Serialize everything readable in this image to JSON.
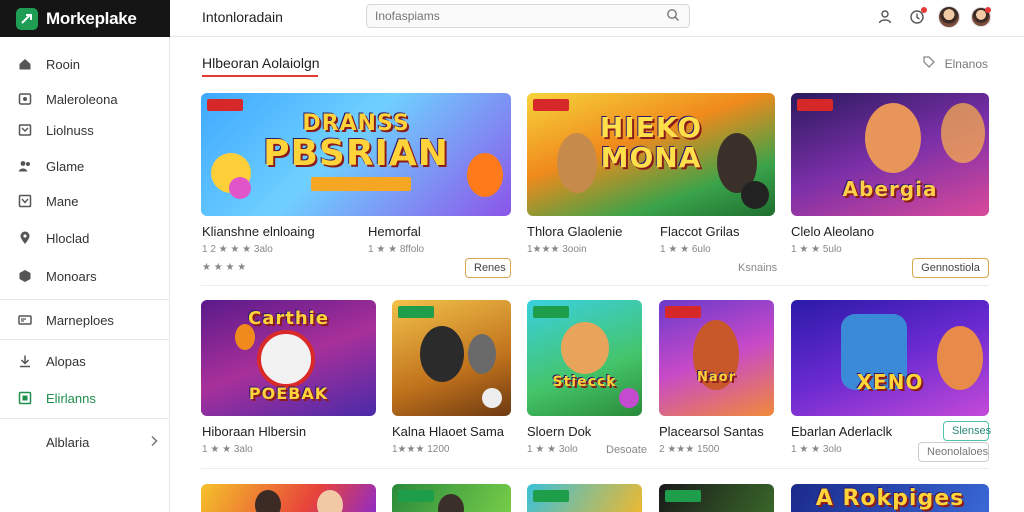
{
  "brand": {
    "name": "Morkeplake"
  },
  "topbar": {
    "title": "Intonloradain",
    "search_placeholder": "Inofaspiams"
  },
  "sidebar": {
    "items": [
      {
        "label": "Rooin",
        "icon": "home-icon"
      },
      {
        "label": "Maleroleona",
        "icon": "store-icon"
      },
      {
        "label": "Liolnuss",
        "icon": "library-icon"
      },
      {
        "label": "Glame",
        "icon": "users-icon"
      },
      {
        "label": "Mane",
        "icon": "bookmark-icon"
      },
      {
        "label": "Hloclad",
        "icon": "location-icon"
      },
      {
        "label": "Monoars",
        "icon": "gamepad-icon"
      },
      {
        "label": "Marneploes",
        "icon": "marketplace-icon"
      },
      {
        "label": "Alopas",
        "icon": "download-icon"
      },
      {
        "label": "Elirlanns",
        "icon": "grid-icon"
      },
      {
        "label": "Alblaria",
        "icon": "chevron-right-icon"
      }
    ]
  },
  "section": {
    "title": "Hlbeoran Aolaiolgn",
    "action": "Elnanos"
  },
  "cards": [
    {
      "title": "Klianshne elnloaing",
      "meta": "",
      "art": "PBSRIAN",
      "top_text": "DRANSS"
    },
    {
      "title": "Hemorfal",
      "meta": "1 ★ ★ 8ffolo",
      "button": "Renes"
    },
    {
      "title": "Thlora Glaolenie",
      "meta": "1★★★ 3ooin",
      "art": "MONA",
      "top_text": "HIEKO"
    },
    {
      "title": "Flaccot Grilas",
      "meta": "1 ★ ★ 6ulo",
      "link": "Ksnains"
    },
    {
      "title": "Clelo Aleolano",
      "meta": "1 ★ ★ 5ulo",
      "art": "Abergia",
      "button": "Gennostiola"
    },
    {
      "title": "Hiboraan Hlbersin",
      "meta": "1 ★ ★ 3alo",
      "art": "POEBAK",
      "top_text": "Carthie"
    },
    {
      "title": "Kalna Hlaoet Sama",
      "meta": "1★★★ 1200"
    },
    {
      "title": "Sloern Dok",
      "meta": "1 ★ ★ 3olo",
      "art": "Stiecck",
      "link": "Desoate"
    },
    {
      "title": "Placearsol Santas",
      "meta": "2 ★★★ 1500",
      "art": "Naor"
    },
    {
      "title": "Ebarlan Aderlaclk",
      "meta": "1 ★ ★ 3olo",
      "art": "XENO",
      "button": "Slenses",
      "button2": "Neonolaloes"
    }
  ],
  "bottom_row_art": "A Rokpiges",
  "counts_meta_first": "1 2 ★ ★ ★ 3alo"
}
